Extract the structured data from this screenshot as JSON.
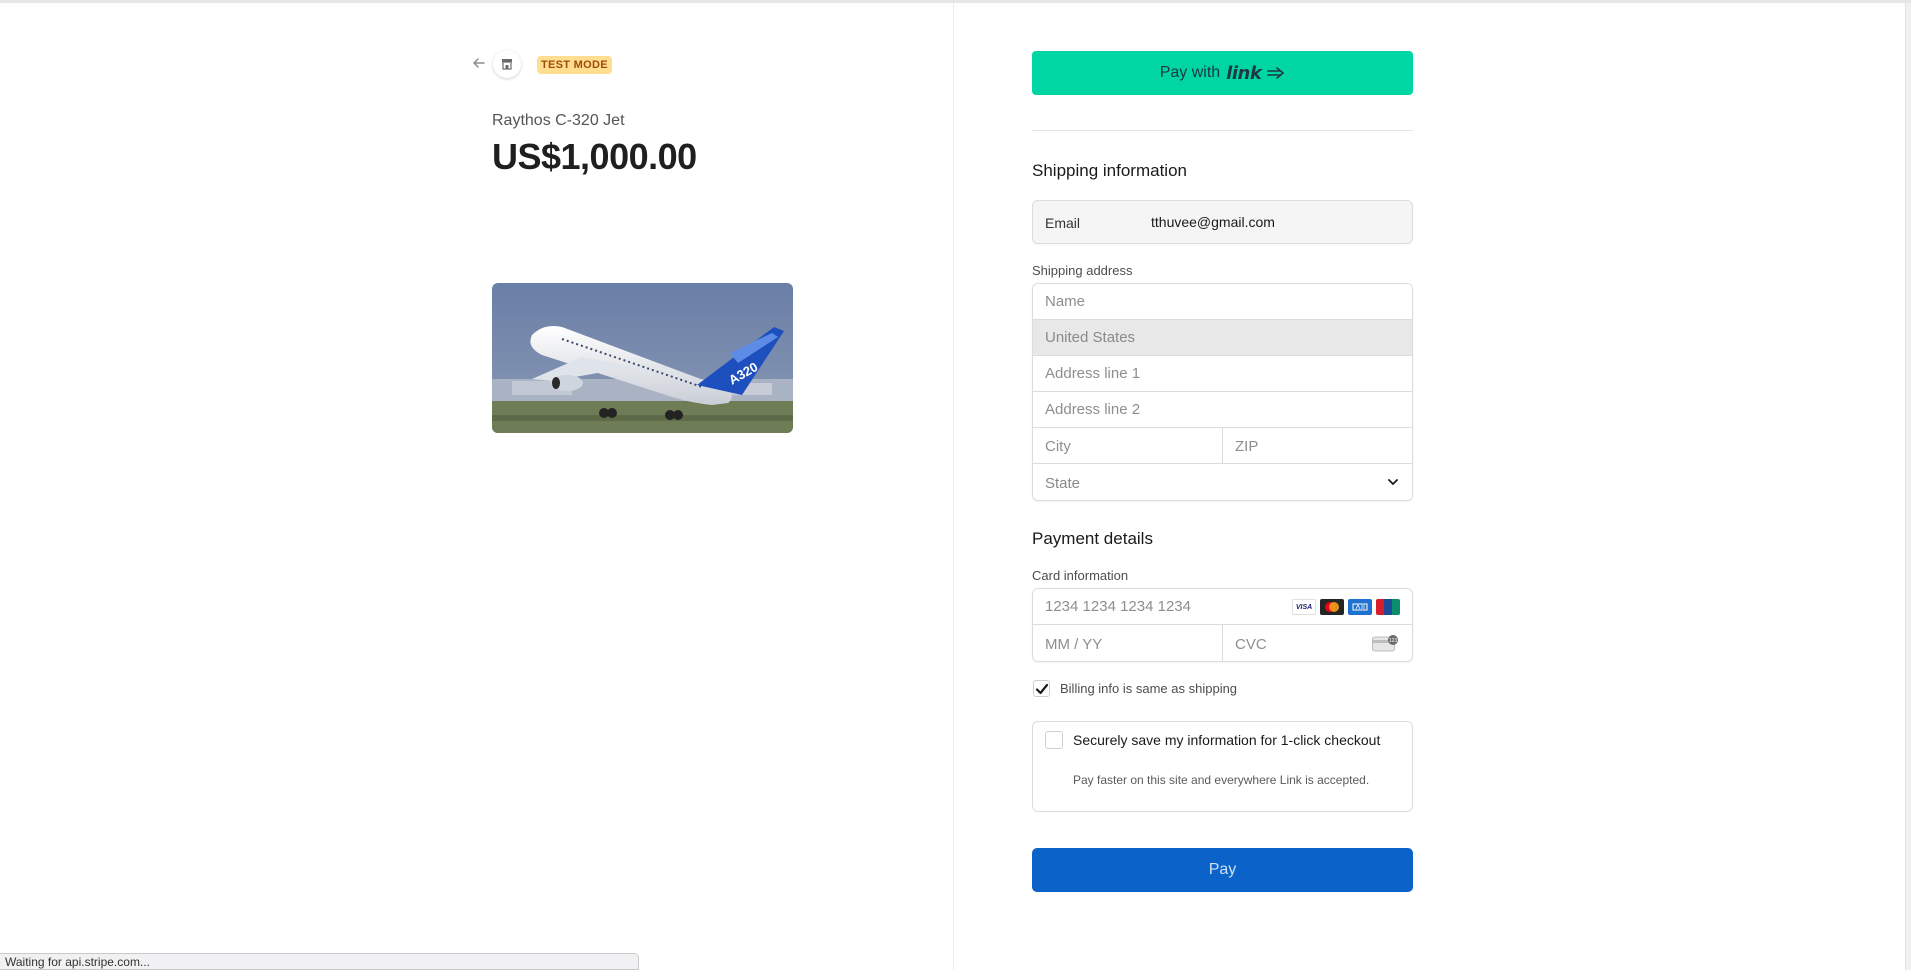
{
  "header": {
    "back_icon": "arrow-left-icon",
    "store_icon": "storefront-icon",
    "badge": "TEST MODE"
  },
  "product": {
    "name": "Raythos C-320 Jet",
    "price": "US$1,000.00",
    "image_icon": "airplane-photo",
    "image_text": "A320"
  },
  "link_button": {
    "prefix": "Pay with",
    "brand": "link",
    "icon": "link-arrow-icon"
  },
  "shipping": {
    "title": "Shipping information",
    "email_label": "Email",
    "email_value": "tthuvee@gmail.com",
    "address_label": "Shipping address",
    "name_placeholder": "Name",
    "country": "United States",
    "address1_placeholder": "Address line 1",
    "address2_placeholder": "Address line 2",
    "city_placeholder": "City",
    "zip_placeholder": "ZIP",
    "state": "State"
  },
  "payment": {
    "title": "Payment details",
    "card_label": "Card information",
    "card_number_placeholder": "1234 1234 1234 1234",
    "expiry_placeholder": "MM / YY",
    "cvc_placeholder": "CVC",
    "card_brands": [
      {
        "name": "VISA",
        "color": "#ffffff"
      },
      {
        "name": "MC",
        "color": "#252525"
      },
      {
        "name": "AMEX",
        "color": "#1f72cd"
      },
      {
        "name": "UnionPay",
        "color": "#d81e2c"
      }
    ],
    "billing_same_label": "Billing info is same as shipping",
    "billing_same_checked": true
  },
  "save_info": {
    "title": "Securely save my information for 1-click checkout",
    "subtitle": "Pay faster on this site and everywhere Link is accepted.",
    "checked": false
  },
  "pay_button": "Pay",
  "status_bar": "Waiting for api.stripe.com...",
  "colors": {
    "link_green": "#00d6a4",
    "pay_blue": "#0b63c9",
    "badge_bg": "#ffde92",
    "badge_text": "#a04b07"
  }
}
